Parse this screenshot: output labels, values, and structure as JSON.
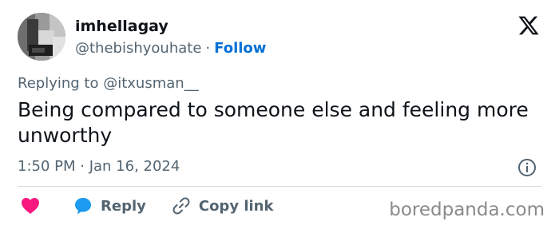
{
  "author": {
    "name": "imhellagay",
    "handle": "@thebishyouhate",
    "separator": "·",
    "follow_label": "Follow"
  },
  "reply_context": "Replying to @itxusman__",
  "tweet": {
    "text": "Being compared to someone else and feeling more unworthy",
    "timestamp": "1:50 PM · Jan 16, 2024"
  },
  "actions": {
    "reply_label": "Reply",
    "copy_link_label": "Copy link"
  },
  "icons": {
    "brand": "x-logo-icon",
    "info": "info-icon",
    "like": "heart-icon",
    "reply": "speech-bubble-icon",
    "copy": "link-icon"
  },
  "watermark": "boredpanda.com",
  "colors": {
    "follow": "#006fd6",
    "heart": "#f91880",
    "reply": "#1d9bf0",
    "secondary_text": "#536471"
  }
}
